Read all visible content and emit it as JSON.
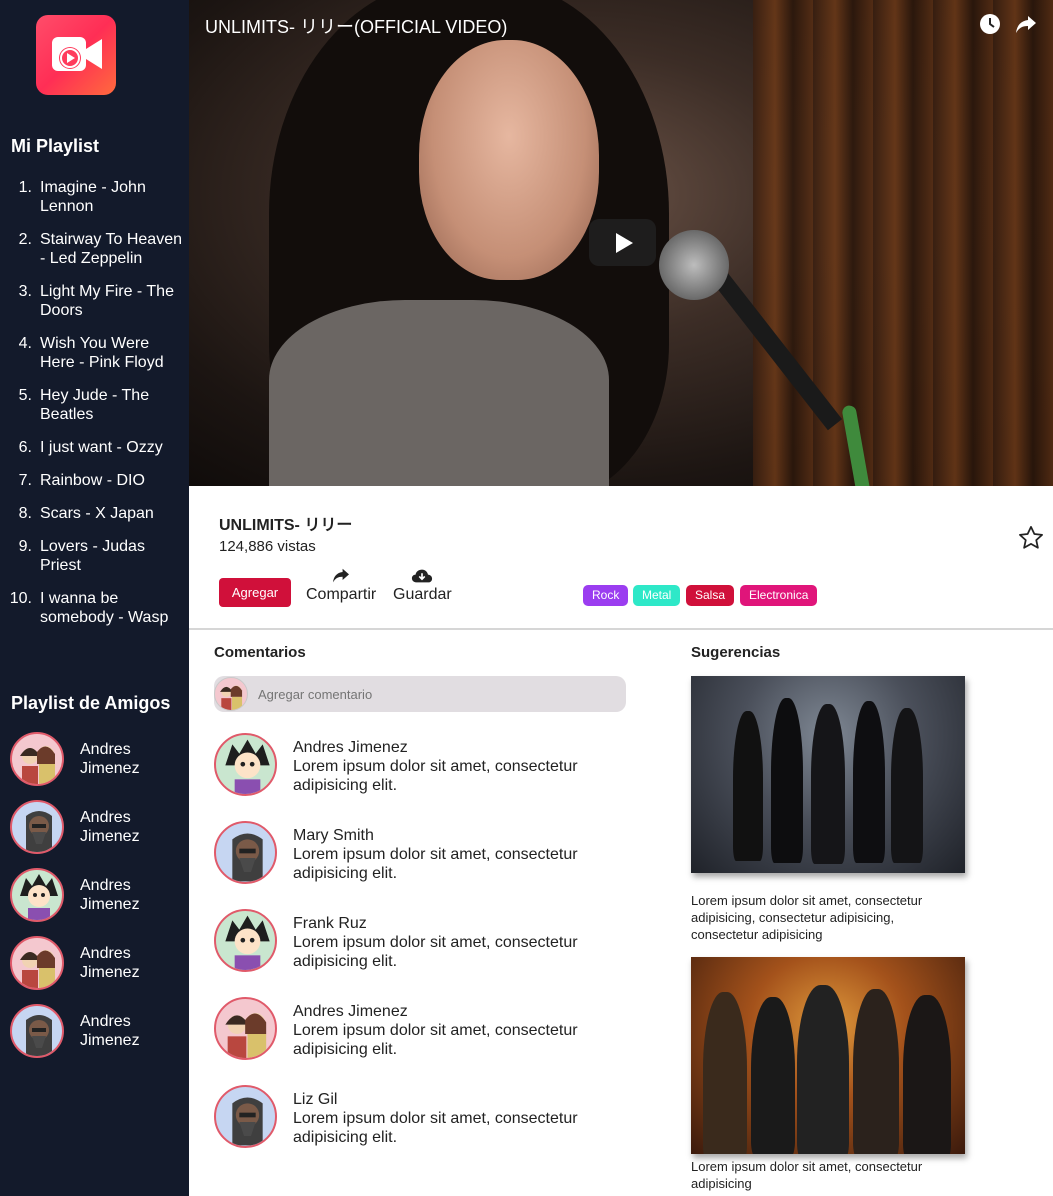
{
  "sidebar": {
    "playlist_title": "Mi Playlist",
    "playlist": [
      {
        "num": "1.",
        "label": "Imagine - John Lennon"
      },
      {
        "num": "2.",
        "label": "Stairway To Heaven - Led Zeppelin"
      },
      {
        "num": "3.",
        "label": "Light My Fire - The Doors"
      },
      {
        "num": "4.",
        "label": "Wish You Were Here - Pink Floyd"
      },
      {
        "num": "5.",
        "label": "Hey Jude - The Beatles"
      },
      {
        "num": "6.",
        "label": "I just want - Ozzy"
      },
      {
        "num": "7.",
        "label": "Rainbow - DIO"
      },
      {
        "num": "8.",
        "label": "Scars - X Japan"
      },
      {
        "num": "9.",
        "label": "Lovers - Judas Priest"
      },
      {
        "num": "10.",
        "label": "I wanna be somebody - Wasp"
      }
    ],
    "friends_title": "Playlist de Amigos",
    "friends": [
      {
        "name": "Andres Jimenez"
      },
      {
        "name": "Andres Jimenez"
      },
      {
        "name": "Andres Jimenez"
      },
      {
        "name": "Andres Jimenez"
      },
      {
        "name": "Andres Jimenez"
      }
    ]
  },
  "video": {
    "title": "UNLIMITS- リリー(OFFICIAL VIDEO)"
  },
  "info": {
    "title": "UNLIMITS- リリー",
    "views": "124,886 vistas",
    "add_label": "Agregar",
    "share_label": "Compartir",
    "save_label": "Guardar",
    "tags": [
      {
        "label": "Rock",
        "color": "#9b3df0"
      },
      {
        "label": "Metal",
        "color": "#2ee8c8"
      },
      {
        "label": "Salsa",
        "color": "#d0103a"
      },
      {
        "label": "Electronica",
        "color": "#e0157a"
      }
    ]
  },
  "comments": {
    "heading": "Comentarios",
    "input_placeholder": "Agregar comentario",
    "items": [
      {
        "author": "Andres Jimenez",
        "text": "Lorem ipsum dolor sit amet, consectetur adipisicing elit."
      },
      {
        "author": "Mary Smith",
        "text": "Lorem ipsum dolor sit amet, consectetur adipisicing elit."
      },
      {
        "author": "Frank Ruz",
        "text": "Lorem ipsum dolor sit amet, consectetur adipisicing elit."
      },
      {
        "author": "Andres Jimenez",
        "text": "Lorem ipsum dolor sit amet, consectetur adipisicing elit."
      },
      {
        "author": "Liz Gil",
        "text": "Lorem ipsum dolor sit amet, consectetur adipisicing elit."
      }
    ]
  },
  "suggestions": {
    "heading": "Sugerencias",
    "items": [
      {
        "text": "Lorem ipsum dolor sit amet, consectetur adipisicing, consectetur adipisicing, consectetur adipisicing"
      },
      {
        "text": "Lorem ipsum dolor sit amet, consectetur adipisicing"
      }
    ]
  }
}
